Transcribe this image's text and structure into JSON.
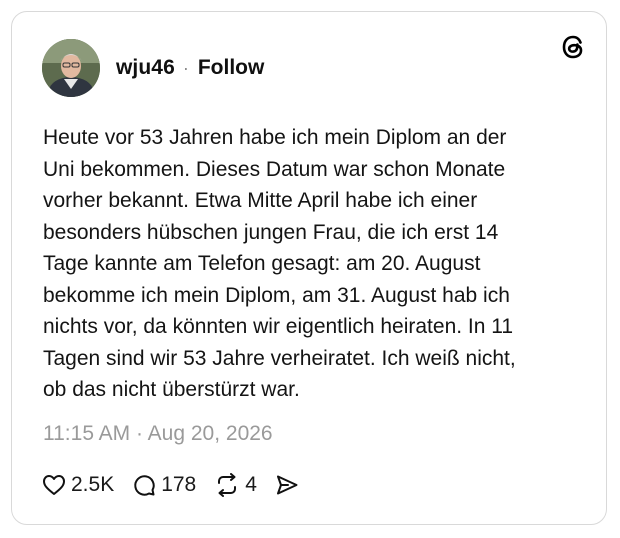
{
  "post": {
    "username": "wju46",
    "separator": "·",
    "follow_label": "Follow",
    "text": "Heute vor 53 Jahren habe ich mein Diplom an der\nUni bekommen. Dieses Datum war schon Monate\nvorher bekannt. Etwa Mitte April habe ich einer\nbesonders hübschen jungen Frau, die ich erst 14\nTage kannte am Telefon gesagt: am 20. August\nbekomme ich mein Diplom, am 31. August hab ich\nnichts vor, da könnten wir eigentlich heiraten. In 11\nTagen sind wir 53 Jahre verheiratet. Ich weiß nicht,\nob das nicht überstürzt war.",
    "timestamp": "11:15 AM · Aug 20, 2026"
  },
  "actions": {
    "likes": "2.5K",
    "replies": "178",
    "reposts": "4"
  },
  "icons": {
    "logo": "threads-logo-icon",
    "like": "heart-icon",
    "reply": "comment-bubble-icon",
    "repost": "repost-icon",
    "share": "send-icon"
  }
}
